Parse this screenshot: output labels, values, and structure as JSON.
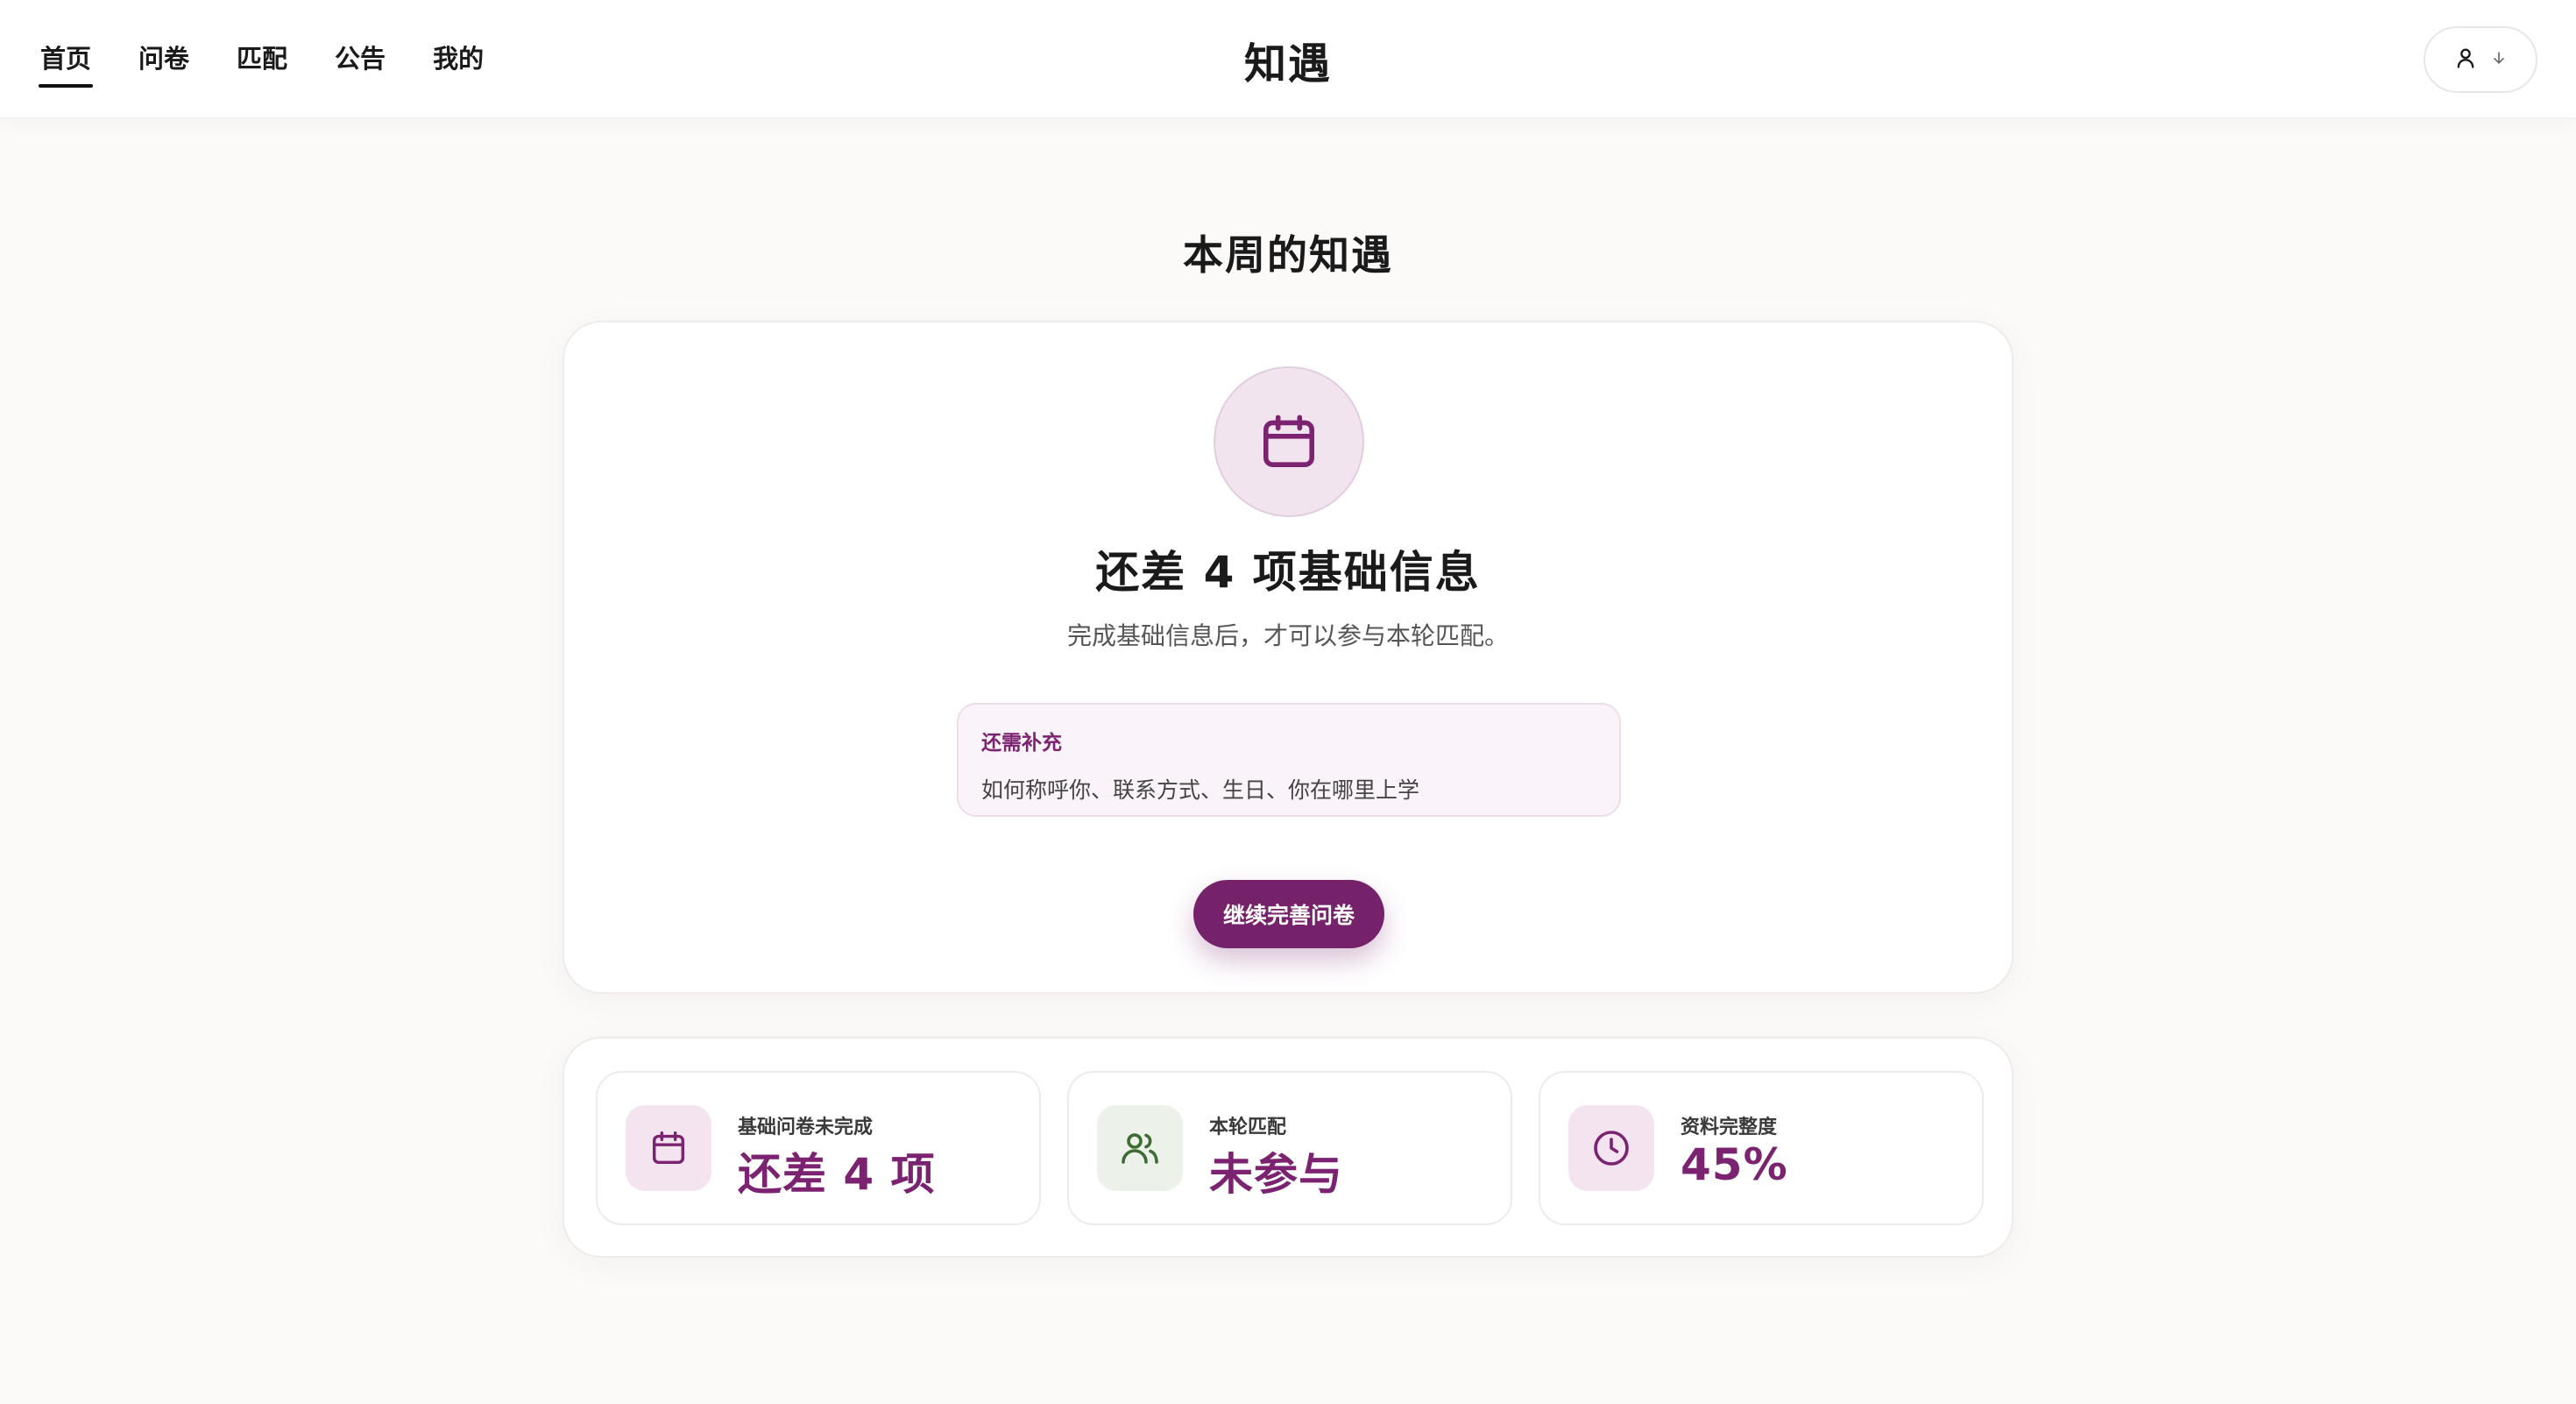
{
  "header": {
    "brand": "知遇",
    "nav": [
      {
        "label": "首页",
        "active": true
      },
      {
        "label": "问卷",
        "active": false
      },
      {
        "label": "匹配",
        "active": false
      },
      {
        "label": "公告",
        "active": false
      },
      {
        "label": "我的",
        "active": false
      }
    ],
    "user_icon": "user-icon",
    "dropdown_icon": "arrow-down-icon"
  },
  "main": {
    "page_title": "本周的知遇",
    "card": {
      "icon": "calendar-icon",
      "title": "还差 4 项基础信息",
      "description": "完成基础信息后，才可以参与本轮匹配。",
      "missing_label": "还需补充",
      "missing_items": "如何称呼你、联系方式、生日、你在哪里上学",
      "cta_label": "继续完善问卷"
    },
    "stats": [
      {
        "icon": "calendar-icon",
        "label": "基础问卷未完成",
        "value": "还差 4 项"
      },
      {
        "icon": "users-icon",
        "label": "本轮匹配",
        "value": "未参与"
      },
      {
        "icon": "clock-icon",
        "label": "资料完整度",
        "value": "45%"
      }
    ]
  },
  "colors": {
    "accent": "#7b2370",
    "accent_dark": "#76226b",
    "icon_bg_purple": "#f3e4f0",
    "icon_bg_green": "#ecf1e9",
    "green_icon": "#3d6b33"
  }
}
